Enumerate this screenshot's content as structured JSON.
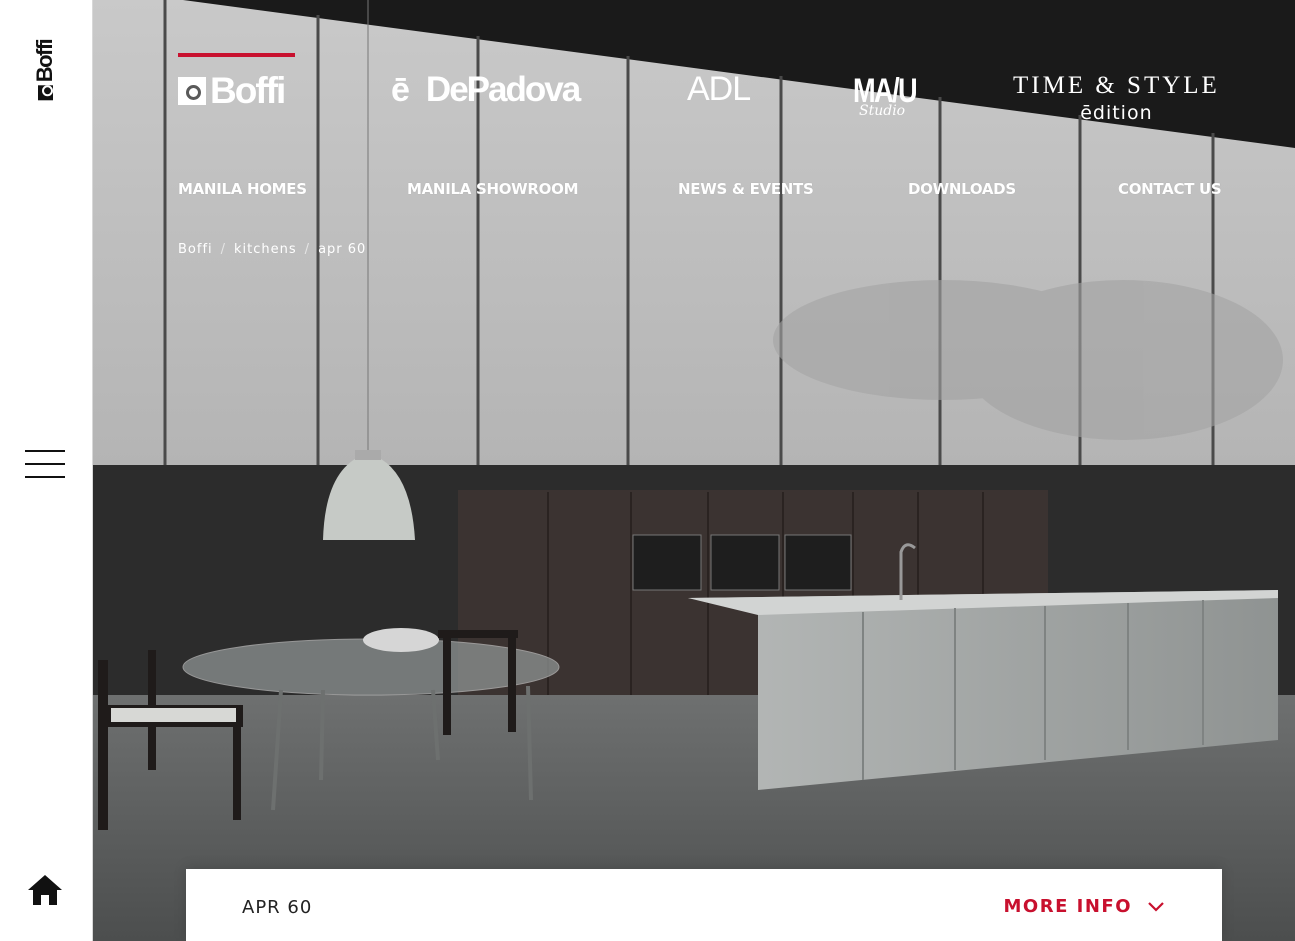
{
  "sidebar": {
    "logo_text": "Boffi",
    "menu_icon": "hamburger-menu-icon",
    "home_icon": "home-icon"
  },
  "brands": {
    "boffi": "Boffi",
    "depadova_mark": "ē",
    "depadova": "DePadova",
    "adl": "ADL",
    "mau": "MA/U",
    "mau_sub": "Studio",
    "time_style": "TIME & STYLE",
    "edition": "ēdition"
  },
  "nav": {
    "items": [
      {
        "label": "MANILA HOMES"
      },
      {
        "label": "MANILA SHOWROOM"
      },
      {
        "label": "NEWS & EVENTS"
      },
      {
        "label": "DOWNLOADS"
      },
      {
        "label": "CONTACT US"
      }
    ]
  },
  "breadcrumb": {
    "items": [
      "Boffi",
      "kitchens",
      "apr 60"
    ],
    "separator": "/"
  },
  "info_bar": {
    "title": "APR 60",
    "more_label": "MORE INFO",
    "chevron_icon": "chevron-down-icon"
  },
  "colors": {
    "accent": "#c8102e",
    "sidebar_bg": "#ffffff",
    "text_dark": "#111111"
  }
}
